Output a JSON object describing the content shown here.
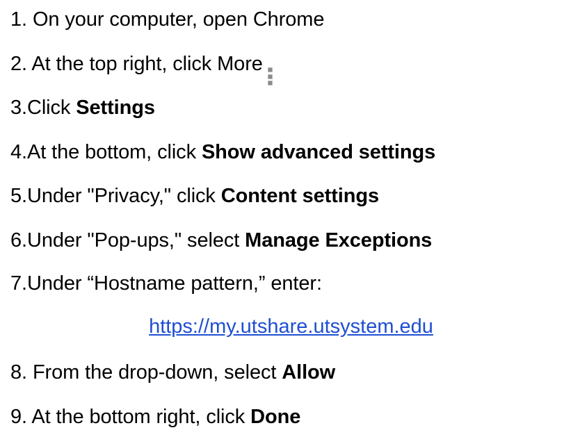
{
  "steps": [
    {
      "text": "1. On your computer, open Chrome"
    },
    {
      "text": "2. At the top right, click More",
      "icon": "kebab-more-icon"
    },
    {
      "text": "3.Click ",
      "bold": "Settings"
    },
    {
      "text": "4.At the bottom, click ",
      "bold": "Show advanced settings"
    },
    {
      "text": "5.Under \"Privacy,\" click ",
      "bold": "Content settings"
    },
    {
      "text": "6.Under \"Pop-ups,\" select ",
      "bold": "Manage Exceptions"
    },
    {
      "text": "7.Under “Hostname pattern,” enter:"
    },
    {
      "text": "8. From the drop-down, select ",
      "bold": "Allow"
    },
    {
      "text": "9. At the bottom right, click ",
      "bold": "Done"
    }
  ],
  "link": {
    "text": "https://my.utshare.utsystem.edu",
    "color": "#1f4fd1"
  }
}
